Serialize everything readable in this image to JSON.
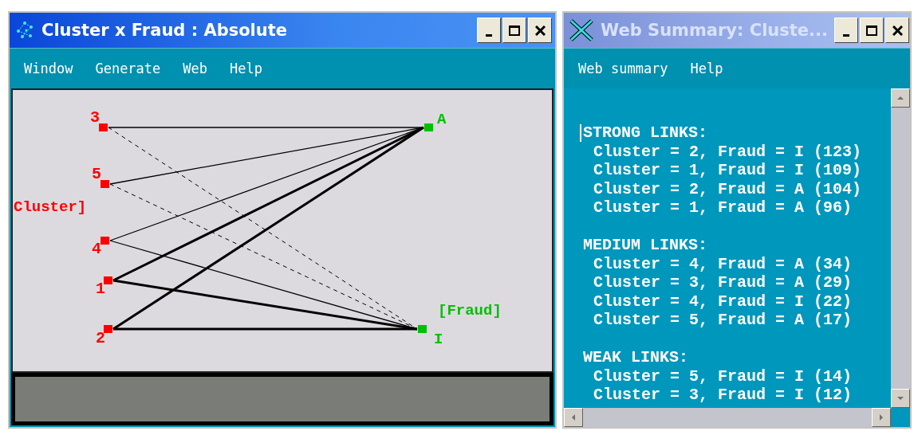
{
  "windows": [
    {
      "kind": "graph",
      "active": true,
      "title": "Cluster x Fraud : Absolute",
      "menu": [
        "Window",
        "Generate",
        "Web",
        "Help"
      ],
      "graph": {
        "left_axis": "Cluster]",
        "right_axis": "[Fraud]",
        "right_nodes": [
          {
            "label": "A"
          },
          {
            "label": "I"
          }
        ],
        "left_nodes": [
          {
            "label": "3",
            "links": [
              {
                "kind": "medium"
              },
              {
                "kind": "weak"
              }
            ]
          },
          {
            "label": "5",
            "links": [
              {
                "kind": "medium"
              },
              {
                "kind": "weak"
              }
            ]
          },
          {
            "label": "4",
            "links": [
              {
                "kind": "medium"
              },
              {
                "kind": "medium"
              }
            ]
          },
          {
            "label": "1",
            "links": [
              {
                "kind": "strong"
              },
              {
                "kind": "strong"
              }
            ]
          },
          {
            "label": "2",
            "links": [
              {
                "kind": "strong"
              },
              {
                "kind": "strong"
              }
            ]
          }
        ]
      }
    },
    {
      "kind": "summary",
      "active": false,
      "title": "Web Summary: Cluste...",
      "menu": [
        "Web summary",
        "Help"
      ],
      "sections": [
        {
          "heading": "STRONG LINKS:",
          "entries": [
            "Cluster = 2, Fraud = I (123)",
            "Cluster = 1, Fraud = I (109)",
            "Cluster = 2, Fraud = A (104)",
            "Cluster = 1, Fraud = A (96)"
          ]
        },
        {
          "heading": "MEDIUM LINKS:",
          "entries": [
            "Cluster = 4, Fraud = A (34)",
            "Cluster = 3, Fraud = A (29)",
            "Cluster = 4, Fraud = I (22)",
            "Cluster = 5, Fraud = A (17)"
          ]
        },
        {
          "heading": "WEAK LINKS:",
          "entries": [
            "Cluster = 5, Fraud = I (14)",
            "Cluster = 3, Fraud = I (12)"
          ]
        }
      ]
    }
  ]
}
